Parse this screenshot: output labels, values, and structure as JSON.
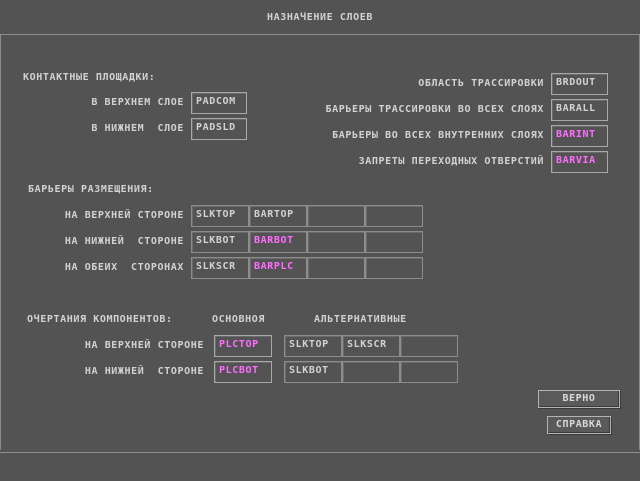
{
  "title": "НАЗНАЧЕНИЕ СЛОЕВ",
  "pads": {
    "header": "КОНТАКТНЫЕ ПЛОЩАДКИ:",
    "top_label": "В ВЕРХНЕМ СЛОЕ",
    "top_value": "PADCOM",
    "bottom_label": "В НИЖНЕМ  СЛОЕ",
    "bottom_value": "PADSLD"
  },
  "routing": {
    "area_label": "ОБЛАСТЬ ТРАССИРОВКИ",
    "area_value": "BRDOUT",
    "all_layers_label": "БАРЬЕРЫ ТРАССИРОВКИ ВО ВСЕХ СЛОЯХ",
    "all_layers_value": "BARALL",
    "inner_label": "БАРЬЕРЫ ВО ВСЕХ ВНУТРЕННИХ СЛОЯХ",
    "inner_value": "BARINT",
    "via_label": "ЗАПРЕТЫ ПЕРЕХОДНЫХ ОТВЕРСТИЙ",
    "via_value": "BARVIA"
  },
  "placement": {
    "header": "БАРЬЕРЫ РАЗМЕЩЕНИЯ:",
    "rows": [
      {
        "label": "НА ВЕРХНЕЙ СТОРОНЕ",
        "cells": [
          "SLKTOP",
          "BARTOP",
          "",
          ""
        ]
      },
      {
        "label": "НА НИЖНЕЙ  СТОРОНЕ",
        "cells": [
          "SLKBOT",
          "BARBOT",
          "",
          ""
        ]
      },
      {
        "label": "НА ОБЕИХ  СТОРОНАХ",
        "cells": [
          "SLKSCR",
          "BARPLC",
          "",
          ""
        ]
      }
    ]
  },
  "outlines": {
    "header": "ОЧЕРТАНИЯ КОМПОНЕНТОВ:",
    "primary_header": "ОСНОВНОЯ",
    "alt_header": "АЛЬТЕРНАТИВНЫЕ",
    "rows": [
      {
        "label": "НА ВЕРХНЕЙ СТОРОНЕ",
        "primary": "PLCTOP",
        "alts": [
          "SLKTOP",
          "SLKSCR",
          ""
        ]
      },
      {
        "label": "НА НИЖНЕЙ  СТОРОНЕ",
        "primary": "PLCBOT",
        "alts": [
          "SLKBOT",
          "",
          ""
        ]
      }
    ]
  },
  "buttons": {
    "ok": "ВЕРНО",
    "help": "СПРАВКА"
  },
  "colors": {
    "background": "#535353",
    "text": "#d2d2d2",
    "highlight": "#ff6cff",
    "border": "#8c8c8c"
  }
}
